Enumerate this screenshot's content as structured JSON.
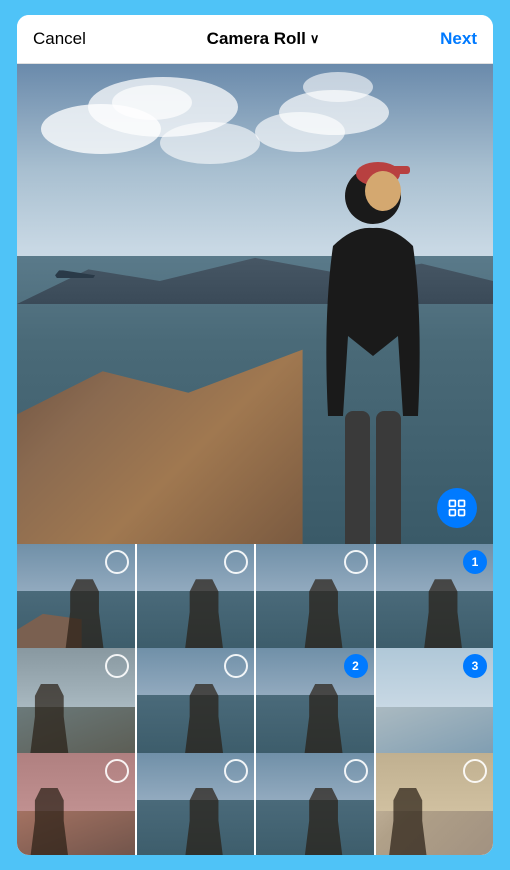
{
  "nav": {
    "cancel_label": "Cancel",
    "title_label": "Camera Roll",
    "chevron": "∨",
    "next_label": "Next"
  },
  "thumbnails": [
    {
      "id": 1,
      "selected": false,
      "badge": null,
      "bg": "tb1"
    },
    {
      "id": 2,
      "selected": false,
      "badge": null,
      "bg": "tb2"
    },
    {
      "id": 3,
      "selected": false,
      "badge": null,
      "bg": "tb3"
    },
    {
      "id": 4,
      "selected": true,
      "badge": "1",
      "bg": "tb4"
    },
    {
      "id": 5,
      "selected": false,
      "badge": null,
      "bg": "tb5"
    },
    {
      "id": 6,
      "selected": false,
      "badge": null,
      "bg": "tb6"
    },
    {
      "id": 7,
      "selected": true,
      "badge": "2",
      "bg": "tb7"
    },
    {
      "id": 8,
      "selected": true,
      "badge": "3",
      "bg": "tb8"
    },
    {
      "id": 9,
      "selected": false,
      "badge": null,
      "bg": "tb9"
    },
    {
      "id": 10,
      "selected": false,
      "badge": null,
      "bg": "tb10"
    },
    {
      "id": 11,
      "selected": false,
      "badge": null,
      "bg": "tb11"
    },
    {
      "id": 12,
      "selected": false,
      "badge": null,
      "bg": "tb12"
    }
  ],
  "expand_icon": "⊡",
  "colors": {
    "accent": "#007AFF",
    "background": "#4fc3f7"
  }
}
